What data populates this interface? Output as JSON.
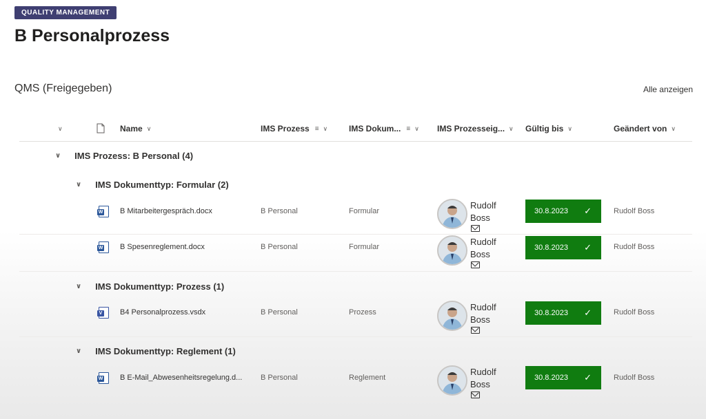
{
  "badge": "QUALITY MANAGEMENT",
  "page_title": "B Personalprozess",
  "section": {
    "title": "QMS (Freigegeben)",
    "show_all": "Alle anzeigen"
  },
  "columns": {
    "name": "Name",
    "ims_prozess": "IMS Prozess",
    "ims_dokument": "IMS Dokum...",
    "ims_prozesseig": "IMS Prozesseig...",
    "gueltig_bis": "Gültig bis",
    "geaendert_von": "Geändert von"
  },
  "groups": {
    "g1": "IMS Prozess: B Personal (4)",
    "g2": "IMS Dokumenttyp: Formular (2)",
    "g3": "IMS Dokumenttyp: Prozess (1)",
    "g4": "IMS Dokumenttyp: Reglement (1)"
  },
  "rows": [
    {
      "name": "B Mitarbeitergespräch.docx",
      "prozess": "B Personal",
      "typ": "Formular",
      "owner_first": "Rudolf",
      "owner_last": "Boss",
      "valid": "30.8.2023",
      "changed": "Rudolf Boss",
      "icon": "word-file-icon"
    },
    {
      "name": "B Spesenreglement.docx",
      "prozess": "B Personal",
      "typ": "Formular",
      "owner_first": "Rudolf",
      "owner_last": "Boss",
      "valid": "30.8.2023",
      "changed": "Rudolf Boss",
      "icon": "word-file-icon"
    },
    {
      "name": "B4 Personalprozess.vsdx",
      "prozess": "B Personal",
      "typ": "Prozess",
      "owner_first": "Rudolf",
      "owner_last": "Boss",
      "valid": "30.8.2023",
      "changed": "Rudolf Boss",
      "icon": "visio-file-icon"
    },
    {
      "name": "B E-Mail_Abwesenheitsregelung.d...",
      "prozess": "B Personal",
      "typ": "Reglement",
      "owner_first": "Rudolf",
      "owner_last": "Boss",
      "valid": "30.8.2023",
      "changed": "Rudolf Boss",
      "icon": "word-file-icon"
    }
  ],
  "icons": {
    "chevron": "chevron-down-icon",
    "check": "checkmark-icon",
    "mail": "mail-icon",
    "filter": "filter-icon",
    "file": "file-icon"
  },
  "colors": {
    "badge": "#3f3f72",
    "valid_green": "#107c10"
  }
}
